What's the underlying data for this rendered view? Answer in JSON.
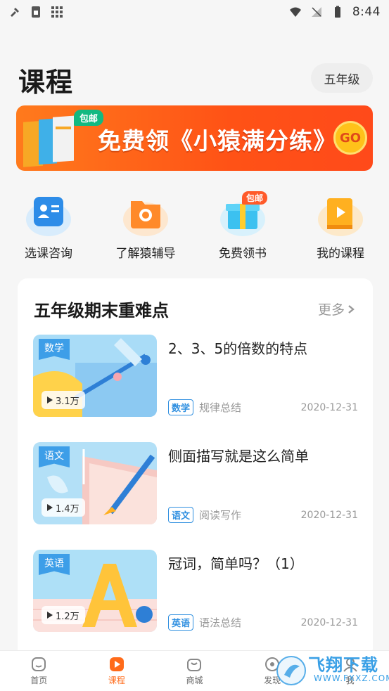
{
  "status_bar": {
    "time": "8:44"
  },
  "header": {
    "title": "课程",
    "grade": "五年级"
  },
  "banner": {
    "badge": "包邮",
    "text": "免费领《小猿满分练》",
    "go": "GO"
  },
  "quick_entries": [
    {
      "label": "选课咨询",
      "icon": "contact-card-icon"
    },
    {
      "label": "了解猿辅导",
      "icon": "folder-icon"
    },
    {
      "label": "免费领书",
      "icon": "gift-box-icon",
      "badge": "包邮"
    },
    {
      "label": "我的课程",
      "icon": "video-book-icon"
    }
  ],
  "section": {
    "title": "五年级期末重难点",
    "more": "更多"
  },
  "courses": [
    {
      "subject": "数学",
      "title": "2、3、5的倍数的特点",
      "views": "3.1万",
      "category": "规律总结",
      "date": "2020-12-31"
    },
    {
      "subject": "语文",
      "title": "侧面描写就是这么简单",
      "views": "1.4万",
      "category": "阅读写作",
      "date": "2020-12-31"
    },
    {
      "subject": "英语",
      "title": "冠词，简单吗？（1）",
      "views": "1.2万",
      "category": "语法总结",
      "date": "2020-12-31"
    }
  ],
  "tabbar": [
    {
      "label": "首页",
      "icon": "home-icon",
      "active": false
    },
    {
      "label": "课程",
      "icon": "play-icon",
      "active": true
    },
    {
      "label": "商城",
      "icon": "shop-bag-icon",
      "active": false
    },
    {
      "label": "发现",
      "icon": "discover-icon",
      "active": false
    },
    {
      "label": "我",
      "icon": "profile-icon",
      "active": false
    }
  ],
  "watermark": {
    "text": "飞翔下载",
    "sub": "WWW.FXXZ.COM"
  },
  "colors": {
    "accent": "#ff6b1a",
    "banner": "#ff5216",
    "tag_blue": "#2f8fe0",
    "badge_green": "#12b981"
  }
}
